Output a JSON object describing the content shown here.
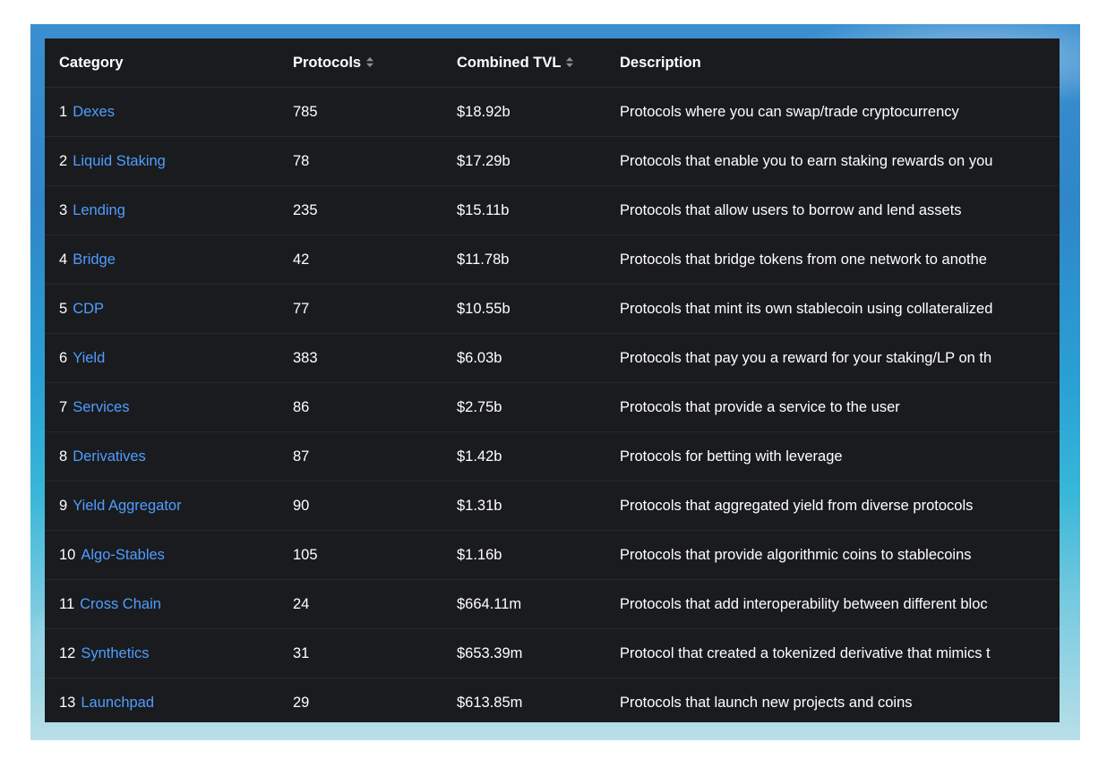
{
  "table": {
    "headers": {
      "category": "Category",
      "protocols": "Protocols",
      "combined_tvl": "Combined TVL",
      "description": "Description"
    },
    "sort_icon": "sort-updown-icon",
    "colors": {
      "background": "#1a1b1e",
      "link": "#4f9dff",
      "text": "#ffffff"
    },
    "rows": [
      {
        "rank": "1",
        "category": "Dexes",
        "protocols": "785",
        "tvl": "$18.92b",
        "description": "Protocols where you can swap/trade cryptocurrency"
      },
      {
        "rank": "2",
        "category": "Liquid Staking",
        "protocols": "78",
        "tvl": "$17.29b",
        "description": "Protocols that enable you to earn staking rewards on you"
      },
      {
        "rank": "3",
        "category": "Lending",
        "protocols": "235",
        "tvl": "$15.11b",
        "description": "Protocols that allow users to borrow and lend assets"
      },
      {
        "rank": "4",
        "category": "Bridge",
        "protocols": "42",
        "tvl": "$11.78b",
        "description": "Protocols that bridge tokens from one network to anothe"
      },
      {
        "rank": "5",
        "category": "CDP",
        "protocols": "77",
        "tvl": "$10.55b",
        "description": "Protocols that mint its own stablecoin using collateralized"
      },
      {
        "rank": "6",
        "category": "Yield",
        "protocols": "383",
        "tvl": "$6.03b",
        "description": "Protocols that pay you a reward for your staking/LP on th"
      },
      {
        "rank": "7",
        "category": "Services",
        "protocols": "86",
        "tvl": "$2.75b",
        "description": "Protocols that provide a service to the user"
      },
      {
        "rank": "8",
        "category": "Derivatives",
        "protocols": "87",
        "tvl": "$1.42b",
        "description": "Protocols for betting with leverage"
      },
      {
        "rank": "9",
        "category": "Yield Aggregator",
        "protocols": "90",
        "tvl": "$1.31b",
        "description": "Protocols that aggregated yield from diverse protocols"
      },
      {
        "rank": "10",
        "category": "Algo-Stables",
        "protocols": "105",
        "tvl": "$1.16b",
        "description": "Protocols that provide algorithmic coins to stablecoins"
      },
      {
        "rank": "11",
        "category": "Cross Chain",
        "protocols": "24",
        "tvl": "$664.11m",
        "description": "Protocols that add interoperability between different bloc"
      },
      {
        "rank": "12",
        "category": "Synthetics",
        "protocols": "31",
        "tvl": "$653.39m",
        "description": "Protocol that created a tokenized derivative that mimics t"
      },
      {
        "rank": "13",
        "category": "Launchpad",
        "protocols": "29",
        "tvl": "$613.85m",
        "description": "Protocols that launch new projects and coins"
      }
    ]
  }
}
